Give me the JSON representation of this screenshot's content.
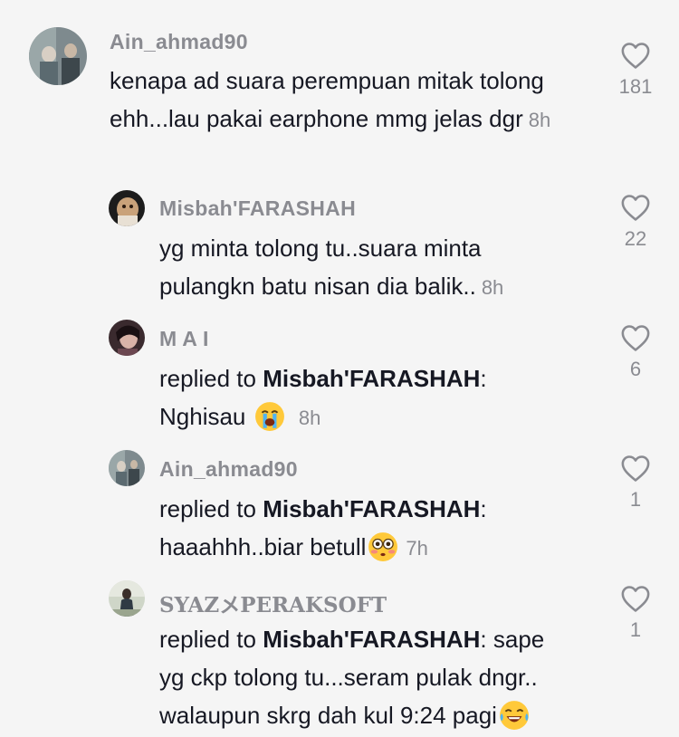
{
  "comments": [
    {
      "username": "Ain_ahmad90",
      "text": "kenapa ad suara perempuan mitak tolong ehh...lau pakai earphone mmg jelas dgr",
      "time": "8h",
      "likes": "181",
      "icon": "heart-outline-icon"
    },
    {
      "username": "Misbah'FARASHAH",
      "text": "yg minta tolong tu..suara minta pulangkn batu nisan dia balik..",
      "time": "8h",
      "likes": "22",
      "icon": "heart-outline-icon"
    },
    {
      "username": "M A I",
      "replied_prefix": "replied to",
      "replied_to": "Misbah'FARASHAH",
      "colon": ":",
      "text": "Nghisau",
      "emoji": "loudly-crying-face",
      "time": "8h",
      "likes": "6",
      "icon": "heart-outline-icon"
    },
    {
      "username": "Ain_ahmad90",
      "replied_prefix": "replied to",
      "replied_to": "Misbah'FARASHAH",
      "colon": ":",
      "text": "haaahhh..biar betull",
      "emoji": "flushed-face",
      "time": "7h",
      "likes": "1",
      "icon": "heart-outline-icon"
    },
    {
      "username": "SYAZメPERAKSOFT",
      "replied_prefix": "replied to",
      "replied_to": "Misbah'FARASHAH",
      "colon": ":",
      "text_line1": "sape",
      "text_line2": "yg ckp tolong tu...seram pulak dngr..",
      "text_line3": "walaupun skrg dah kul 9:24 pagi",
      "emoji": "face-with-tears-of-joy",
      "likes": "1",
      "icon": "heart-outline-icon"
    }
  ]
}
